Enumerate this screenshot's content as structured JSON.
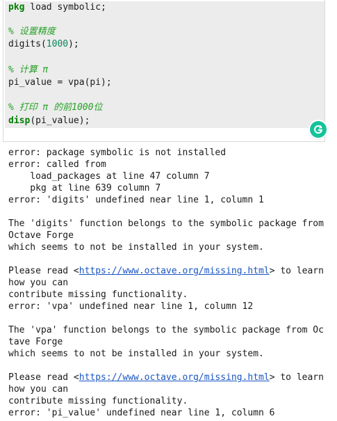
{
  "code": {
    "line1": {
      "kw": "pkg",
      "rest": " load symbolic;"
    },
    "line2": {
      "text": "% 设置精度"
    },
    "line3": {
      "pre": "digits(",
      "num": "1000",
      "post": ");"
    },
    "line4": {
      "text": "% 计算 π"
    },
    "line5": {
      "text": "pi_value = vpa(pi);"
    },
    "line6": {
      "text": "% 打印 π 的前1000位"
    },
    "line7": {
      "kw": "disp",
      "rest": "(pi_value);"
    }
  },
  "grammarly": {
    "icon": "grammarly-icon",
    "color": "#15c39a"
  },
  "output": {
    "l1": "error: package symbolic is not installed",
    "l2": "error: called from",
    "l3": "    load_packages at line 47 column 7",
    "l4": "    pkg at line 639 column 7",
    "l5": "error: 'digits' undefined near line 1, column 1",
    "l6": "",
    "l7": "The 'digits' function belongs to the symbolic package from",
    "l8": "Octave Forge",
    "l9": "which seems to not be installed in your system.",
    "l10": "",
    "l11_pre": "Please read <",
    "l11_link": "https://www.octave.org/missing.html",
    "l11_post": "> to learn",
    "l12": "how you can",
    "l13": "contribute missing functionality.",
    "l14": "error: 'vpa' undefined near line 1, column 12",
    "l15": "",
    "l16": "The 'vpa' function belongs to the symbolic package from Oc",
    "l17": "tave Forge",
    "l18": "which seems to not be installed in your system.",
    "l19": "",
    "l20_pre": "Please read <",
    "l20_link": "https://www.octave.org/missing.html",
    "l20_post": "> to learn",
    "l21": "how you can",
    "l22": "contribute missing functionality.",
    "l23": "error: 'pi_value' undefined near line 1, column 6"
  }
}
